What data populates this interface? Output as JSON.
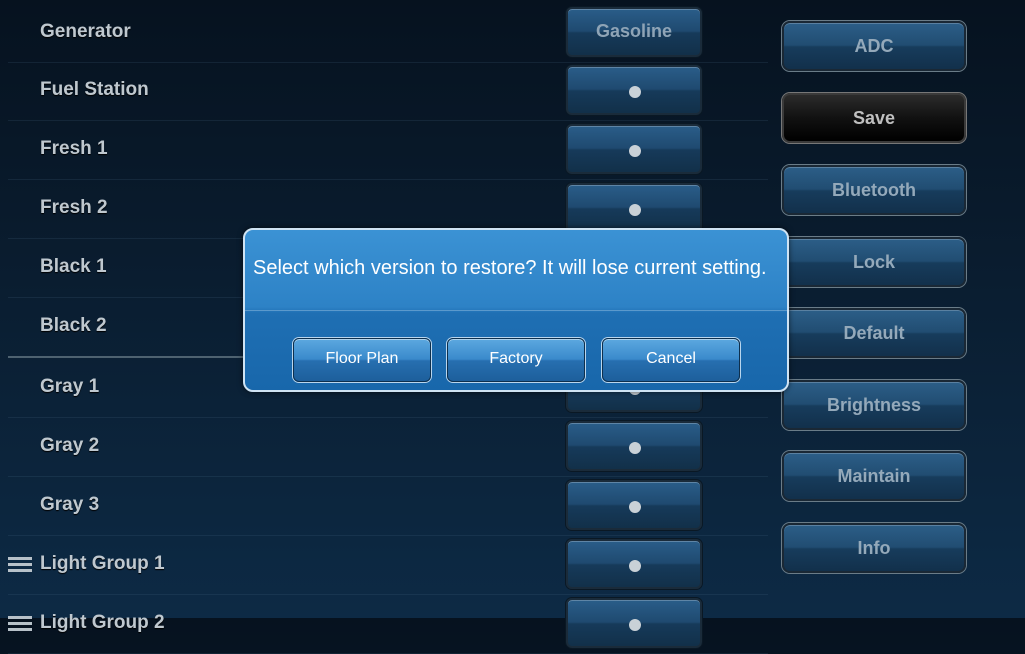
{
  "rows": [
    {
      "label": "Generator",
      "control": "Gasoline"
    },
    {
      "label": "Fuel Station",
      "control": "dot"
    },
    {
      "label": "Fresh 1",
      "control": "dot"
    },
    {
      "label": "Fresh 2",
      "control": "dot"
    },
    {
      "label": "Black 1",
      "control": "dot"
    },
    {
      "label": "Black 2",
      "control": "dot"
    },
    {
      "label": "Gray 1",
      "control": "dot"
    },
    {
      "label": "Gray 2",
      "control": "dot"
    },
    {
      "label": "Gray 3",
      "control": "dot"
    },
    {
      "label": "Light Group 1",
      "control": "dot",
      "icon": "menu-icon"
    },
    {
      "label": "Light Group 2",
      "control": "dot",
      "icon": "menu-icon"
    }
  ],
  "side_buttons": {
    "adc": "ADC",
    "save": "Save",
    "bluetooth": "Bluetooth",
    "lock": "Lock",
    "default": "Default",
    "brightness": "Brightness",
    "maintain": "Maintain",
    "info": "Info"
  },
  "dialog": {
    "message": "Select which version to restore? It will lose current setting.",
    "floor_plan": "Floor Plan",
    "factory": "Factory",
    "cancel": "Cancel"
  },
  "colors": {
    "dialog_bg": "#2d82c6",
    "background": "#0a1d30"
  }
}
